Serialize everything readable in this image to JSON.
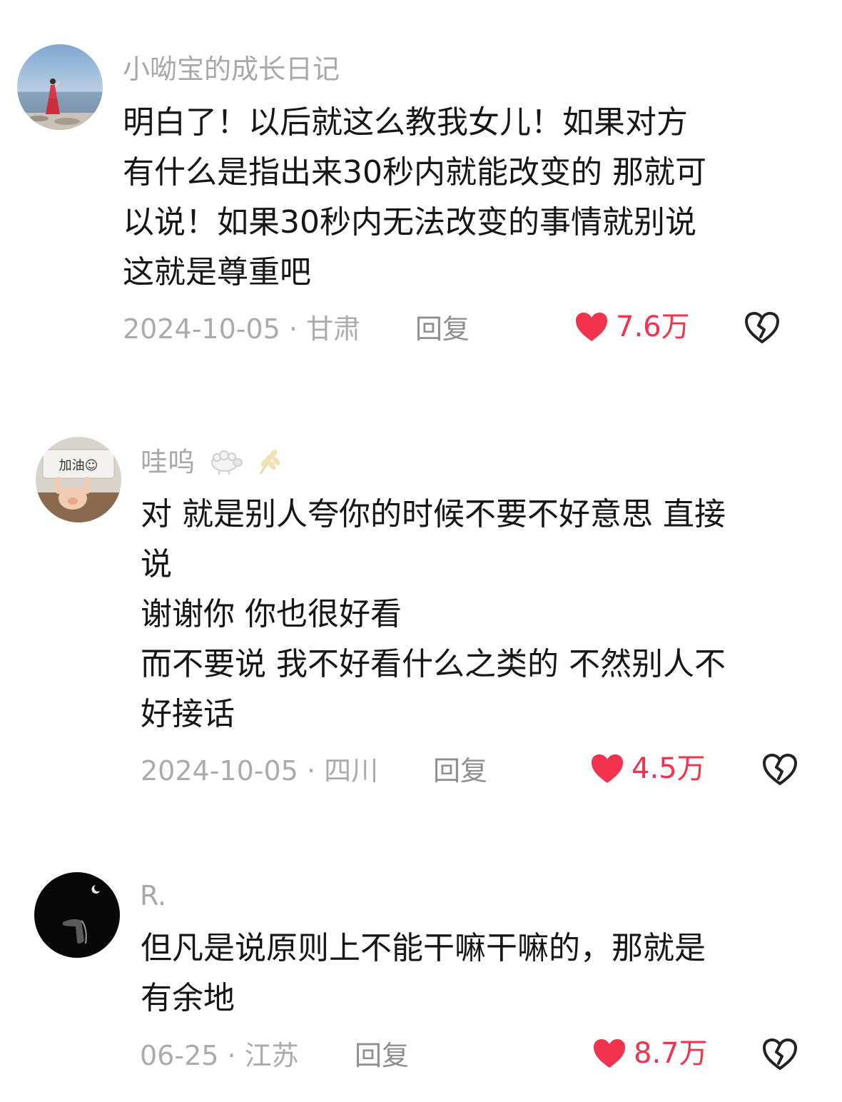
{
  "colors": {
    "like_red": "#f1334e",
    "username_gray": "#a8a8a8",
    "meta_gray": "#ababab",
    "text_black": "#161616"
  },
  "comments": [
    {
      "username": "小呦宝的成长日记",
      "lines": [
        "明白了！以后就这么教我女儿！如果对方",
        "有什么是指出来30秒内就能改变的 那就可",
        "以说！如果30秒内无法改变的事情就别说",
        "这就是尊重吧"
      ],
      "date_location": "2024-10-05 · 甘肃",
      "reply_label": "回复",
      "likes": "7.6万",
      "like_icon": "heart-filled-icon",
      "dislike_icon": "broken-heart-icon"
    },
    {
      "username": "哇呜",
      "username_decorations": [
        "sheep-icon",
        "wheat-icon"
      ],
      "avatar_sign_text": "加油☺",
      "lines": [
        "对 就是别人夸你的时候不要不好意思 直接",
        "说",
        "谢谢你 你也很好看",
        "而不要说 我不好看什么之类的 不然别人不",
        "好接话"
      ],
      "date_location": "2024-10-05 · 四川",
      "reply_label": "回复",
      "likes": "4.5万",
      "like_icon": "heart-filled-icon",
      "dislike_icon": "broken-heart-icon"
    },
    {
      "username": "R.",
      "lines": [
        "但凡是说原则上不能干嘛干嘛的，那就是",
        "有余地"
      ],
      "date_location": "06-25 · 江苏",
      "reply_label": "回复",
      "likes": "8.7万",
      "like_icon": "heart-filled-icon",
      "dislike_icon": "broken-heart-icon"
    }
  ]
}
